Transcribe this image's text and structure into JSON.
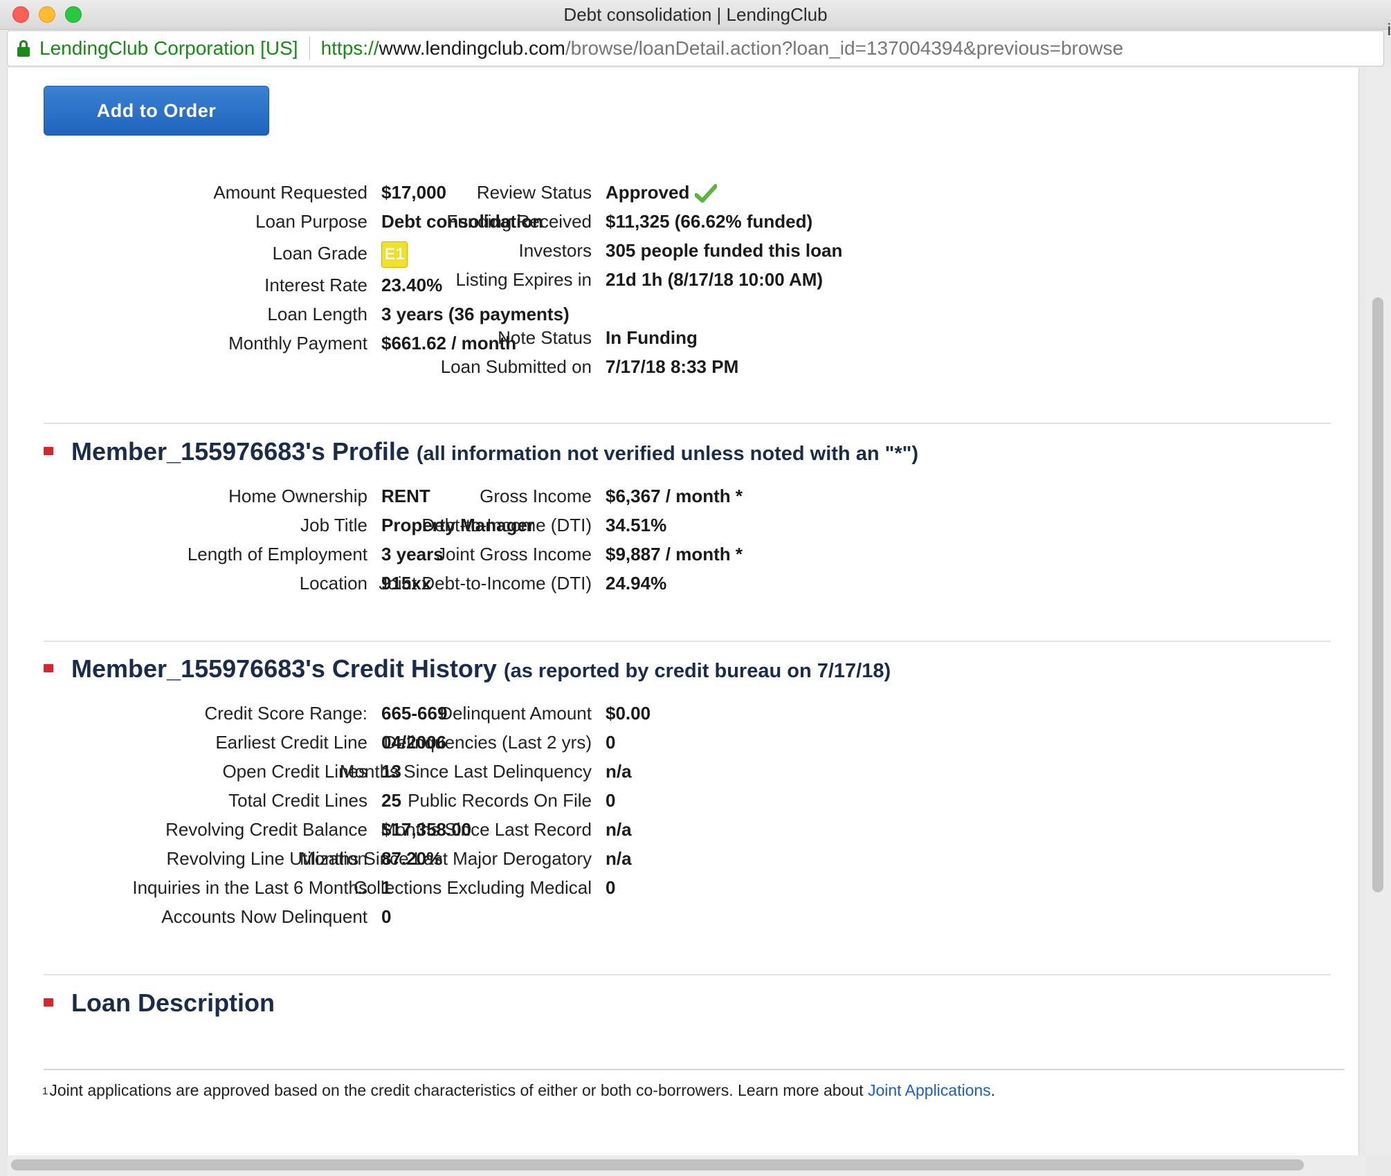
{
  "window": {
    "title": "Debt consolidation | LendingClub"
  },
  "address_bar": {
    "ev_label": "LendingClub Corporation [US]",
    "url_scheme": "https://",
    "url_host": "www.lendingclub.com",
    "url_path": "/browse/loanDetail.action?loan_id=137004394&previous=browse",
    "side_char": "i"
  },
  "actions": {
    "add_to_order": "Add to Order"
  },
  "loan": {
    "left": [
      {
        "label": "Amount Requested",
        "value": "$17,000"
      },
      {
        "label": "Loan Purpose",
        "value": "Debt consolidation"
      },
      {
        "label": "Loan Grade",
        "value": "E1"
      },
      {
        "label": "Interest Rate",
        "value": "23.40%"
      },
      {
        "label": "Loan Length",
        "value": "3 years (36 payments)"
      },
      {
        "label": "Monthly Payment",
        "value": "$661.62 / month"
      }
    ],
    "right": [
      {
        "label": "Review Status",
        "value": "Approved"
      },
      {
        "label": "Funding Received",
        "value": "$11,325 (66.62% funded)"
      },
      {
        "label": "Investors",
        "value": "305 people funded this loan"
      },
      {
        "label": "Listing Expires in",
        "value": "21d 1h (8/17/18 10:00 AM)"
      },
      {
        "label": "Note Status",
        "value": "In Funding"
      },
      {
        "label": "Loan Submitted on",
        "value": "7/17/18 8:33 PM"
      }
    ]
  },
  "profile": {
    "title": "Member_155976683's Profile",
    "subtitle": "(all information not verified unless noted with an \"*\")",
    "left": [
      {
        "label": "Home Ownership",
        "value": "RENT"
      },
      {
        "label": "Job Title",
        "value": "Property Manager"
      },
      {
        "label": "Length of Employment",
        "value": "3 years"
      },
      {
        "label": "Location",
        "value": "915xx"
      }
    ],
    "right": [
      {
        "label": "Gross Income",
        "value": "$6,367 / month *"
      },
      {
        "label": "Debt-to-Income (DTI)",
        "value": "34.51%"
      },
      {
        "label": "Joint Gross Income",
        "value": "$9,887 / month *"
      },
      {
        "label": "Joint Debt-to-Income (DTI)",
        "value": "24.94%"
      }
    ]
  },
  "credit_history": {
    "title": "Member_155976683's Credit History",
    "subtitle": "(as reported by credit bureau on 7/17/18)",
    "left": [
      {
        "label": "Credit Score Range:",
        "value": "665-669"
      },
      {
        "label": "Earliest Credit Line",
        "value": "04/2006"
      },
      {
        "label": "Open Credit Lines",
        "value": "13"
      },
      {
        "label": "Total Credit Lines",
        "value": "25"
      },
      {
        "label": "Revolving Credit Balance",
        "value": "$17,358.00"
      },
      {
        "label": "Revolving Line Utilization",
        "value": "87.20%"
      },
      {
        "label": "Inquiries in the Last 6 Months",
        "value": "1"
      },
      {
        "label": "Accounts Now Delinquent",
        "value": "0"
      }
    ],
    "right": [
      {
        "label": "Delinquent Amount",
        "value": "$0.00"
      },
      {
        "label": "Delinquencies (Last 2 yrs)",
        "value": "0"
      },
      {
        "label": "Months Since Last Delinquency",
        "value": "n/a"
      },
      {
        "label": "Public Records On File",
        "value": "0"
      },
      {
        "label": "Months Since Last Record",
        "value": "n/a"
      },
      {
        "label": "Months Since Last Major Derogatory",
        "value": "n/a"
      },
      {
        "label": "Collections Excluding Medical",
        "value": "0"
      }
    ]
  },
  "loan_description": {
    "title": "Loan Description"
  },
  "footnote": {
    "marker": "1",
    "text": "Joint applications are approved based on the credit characteristics of either or both co-borrowers. Learn more about ",
    "link": "Joint Applications",
    "end": "."
  },
  "colors": {
    "accent_blue": "#1f63bd",
    "ev_green": "#178a17",
    "section_bullet": "#d9262e",
    "grade_yellow": "#f2e126"
  }
}
